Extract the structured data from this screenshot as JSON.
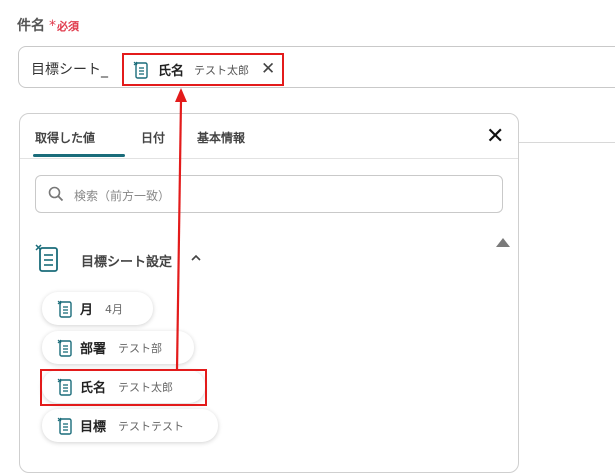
{
  "field": {
    "label": "件名",
    "required_mark": "*",
    "required_text": "必須"
  },
  "subject": {
    "text": "目標シート_"
  },
  "chip": {
    "name": "氏名",
    "value": "テスト太郎"
  },
  "tabs": [
    {
      "label": "取得した値"
    },
    {
      "label": "日付"
    },
    {
      "label": "基本情報"
    }
  ],
  "search": {
    "placeholder": "検索（前方一致）"
  },
  "group": {
    "title": "目標シート設定"
  },
  "items": [
    {
      "name": "月",
      "value": "4月"
    },
    {
      "name": "部署",
      "value": "テスト部"
    },
    {
      "name": "氏名",
      "value": "テスト太郎"
    },
    {
      "name": "目標",
      "value": "テストテスト"
    }
  ],
  "colors": {
    "accent": "#1a6c7a",
    "highlight": "#e31b1b",
    "required": "#e0394b"
  }
}
